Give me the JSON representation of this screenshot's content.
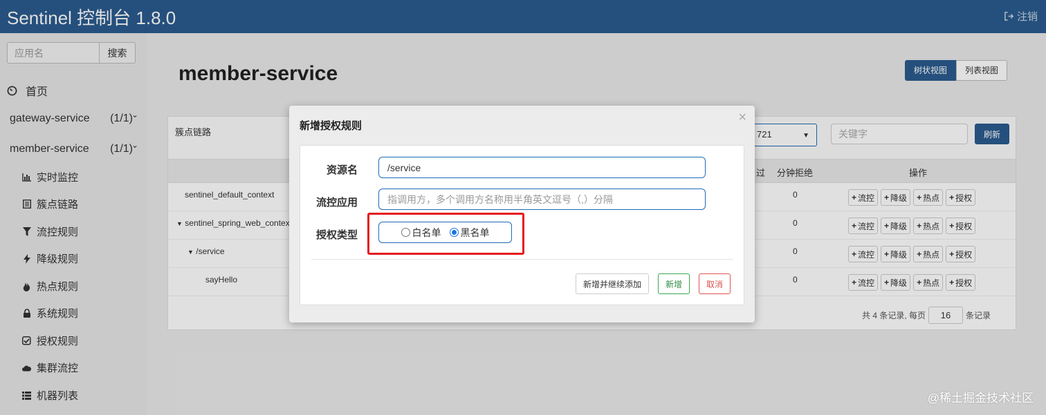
{
  "header": {
    "brand": "Sentinel 控制台 1.8.0",
    "logout": "注销"
  },
  "sidebar": {
    "search_placeholder": "应用名",
    "search_button": "搜索",
    "home": "首页",
    "apps": [
      {
        "name": "gateway-service",
        "count": "(1/1)"
      },
      {
        "name": "member-service",
        "count": "(1/1)"
      }
    ],
    "sub_items": [
      {
        "label": "实时监控",
        "icon": "bar-chart-icon"
      },
      {
        "label": "簇点链路",
        "icon": "list-icon"
      },
      {
        "label": "流控规则",
        "icon": "filter-icon"
      },
      {
        "label": "降级规则",
        "icon": "flash-icon"
      },
      {
        "label": "热点规则",
        "icon": "fire-icon"
      },
      {
        "label": "系统规则",
        "icon": "lock-icon"
      },
      {
        "label": "授权规则",
        "icon": "check-square-icon"
      },
      {
        "label": "集群流控",
        "icon": "cloud-icon"
      },
      {
        "label": "机器列表",
        "icon": "th-list-icon"
      }
    ]
  },
  "main": {
    "title": "member-service",
    "view_tree": "树状视图",
    "view_list": "列表视图",
    "panel_title": "簇点链路",
    "machine": "721",
    "keyword_placeholder": "关键字",
    "refresh": "刷新",
    "headers": {
      "passed": "过",
      "rejected": "分钟拒绝",
      "ops": "操作"
    },
    "rows": [
      {
        "resource": "sentinel_default_context",
        "arrow": "",
        "value": "0"
      },
      {
        "resource": "sentinel_spring_web_context",
        "arrow": "▼",
        "value": "0"
      },
      {
        "resource": "/service",
        "arrow": "▼",
        "value": "0"
      },
      {
        "resource": "sayHello",
        "arrow": "",
        "value": "0"
      }
    ],
    "op_buttons": [
      "流控",
      "降级",
      "热点",
      "授权"
    ],
    "pager": {
      "prefix": "共 4 条记录, 每页",
      "size": "16",
      "suffix": "条记录"
    }
  },
  "modal": {
    "title": "新增授权规则",
    "close": "×",
    "resource_label": "资源名",
    "resource_value": "/service",
    "app_label": "流控应用",
    "app_placeholder": "指调用方，多个调用方名称用半角英文逗号（,）分隔",
    "type_label": "授权类型",
    "white": "白名单",
    "black": "黑名单",
    "selected": "black",
    "btn_continue": "新增并继续添加",
    "btn_add": "新增",
    "btn_cancel": "取消"
  },
  "watermark": "@稀土掘金技术社区"
}
